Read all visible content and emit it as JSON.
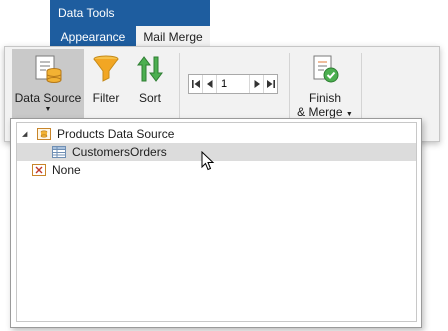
{
  "context_tab_group": {
    "title": "Data Tools"
  },
  "tabs": [
    {
      "label": "Appearance",
      "active": false
    },
    {
      "label": "Mail Merge",
      "active": true
    }
  ],
  "ribbon": {
    "data_source": {
      "label": "Data Source",
      "icon": "data-source-icon"
    },
    "filter": {
      "label": "Filter",
      "icon": "funnel-icon"
    },
    "sort": {
      "label": "Sort",
      "icon": "sort-arrows-icon"
    },
    "navigator": {
      "current_record": "1"
    },
    "finish_merge": {
      "label_line1": "Finish",
      "label_line2": "& Merge",
      "icon": "finish-merge-icon"
    }
  },
  "data_source_tree": {
    "items": [
      {
        "label": "Products Data Source",
        "icon": "datasource-node-icon",
        "expanded": true
      },
      {
        "label": "CustomersOrders",
        "icon": "table-icon",
        "selected": true
      },
      {
        "label": "None",
        "icon": "none-icon"
      }
    ]
  },
  "colors": {
    "context_blue": "#1e5d9f",
    "ribbon_bg": "#f2f2f2",
    "pressed_button": "#c9c9c9",
    "selected_row": "#dcdcdc"
  }
}
